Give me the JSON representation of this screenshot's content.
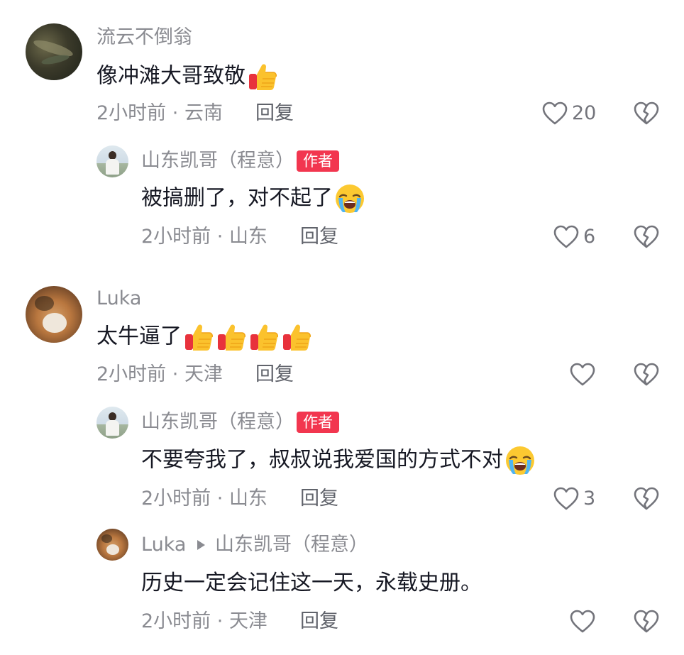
{
  "comments": [
    {
      "user": "流云不倒翁",
      "text": "像冲滩大哥致敬",
      "time": "2小时前",
      "location": "云南",
      "reply_label": "回复",
      "likes": "20",
      "emoji": [
        "thumbs-up"
      ]
    },
    {
      "user": "山东凯哥（程意）",
      "badge": "作者",
      "text": "被搞删了，对不起了",
      "time": "2小时前",
      "location": "山东",
      "reply_label": "回复",
      "likes": "6",
      "emoji": [
        "loudly-crying-face"
      ]
    },
    {
      "user": "Luka",
      "text": "太牛逼了",
      "time": "2小时前",
      "location": "天津",
      "reply_label": "回复",
      "likes": "",
      "emoji": [
        "thumbs-up",
        "thumbs-up",
        "thumbs-up",
        "thumbs-up"
      ]
    },
    {
      "user": "山东凯哥（程意）",
      "badge": "作者",
      "text": "不要夸我了，叔叔说我爱国的方式不对",
      "time": "2小时前",
      "location": "山东",
      "reply_label": "回复",
      "likes": "3",
      "emoji": [
        "loudly-crying-face"
      ]
    },
    {
      "user": "Luka",
      "reply_to": "山东凯哥（程意）",
      "text": "历史一定会记住这一天，永载史册。",
      "time": "2小时前",
      "location": "天津",
      "reply_label": "回复",
      "likes": "",
      "emoji": []
    }
  ],
  "meta_separator": " · ",
  "colors": {
    "badge": "#f2364f",
    "name": "#8a8b91",
    "text": "#161823"
  }
}
